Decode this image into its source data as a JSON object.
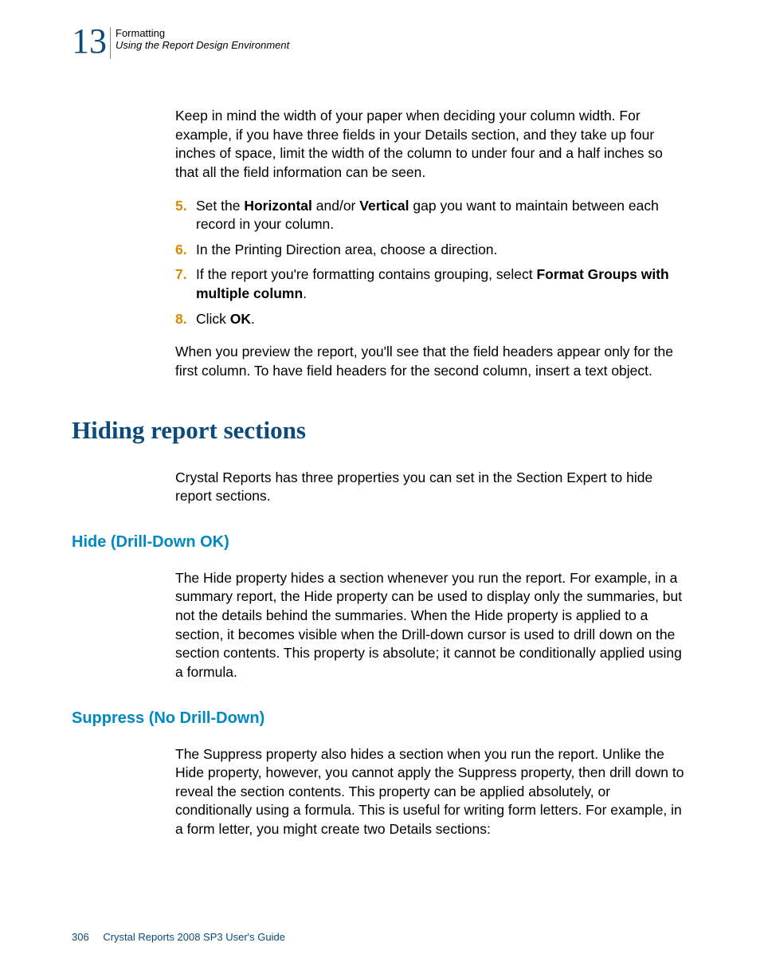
{
  "header": {
    "chapter_number": "13",
    "chapter_title": "Formatting",
    "section_title": "Using the Report Design Environment"
  },
  "body": {
    "intro_para": "Keep in mind the width of your paper when deciding your column width. For example, if you have three fields in your Details section, and they take up four inches of space, limit the width of the column to under four and a half inches so that all the field information can be seen.",
    "step5": {
      "num": "5.",
      "pre": "Set the ",
      "b1": "Horizontal",
      "mid": " and/or ",
      "b2": "Vertical",
      "post": " gap you want to maintain between each record in your column."
    },
    "step6": {
      "num": "6.",
      "text": "In the Printing Direction area, choose a direction."
    },
    "step7": {
      "num": "7.",
      "pre": "If the report you're formatting contains grouping, select ",
      "b1": "Format Groups with multiple column",
      "post": "."
    },
    "step8": {
      "num": "8.",
      "pre": "Click ",
      "b1": "OK",
      "post": "."
    },
    "outro_para": "When you preview the report, you'll see that the field headers appear only for the first column. To have field headers for the second column, insert a text object."
  },
  "h1": "Hiding report sections",
  "hiding_intro": "Crystal Reports has three properties you can set in the Section Expert to hide report sections.",
  "hide": {
    "title": "Hide (Drill-Down OK)",
    "body": "The Hide property hides a section whenever you run the report. For example, in a summary report, the Hide property can be used to display only the summaries, but not the details behind the summaries. When the Hide property is applied to a section, it becomes visible when the Drill-down cursor is used to drill down on the section contents. This property is absolute; it cannot be conditionally applied using a formula."
  },
  "suppress": {
    "title": "Suppress (No Drill-Down)",
    "body": "The Suppress property also hides a section when you run the report. Unlike the Hide property, however, you cannot apply the Suppress property, then drill down to reveal the section contents. This property can be applied absolutely, or conditionally using a formula. This is useful for writing form letters. For example, in a form letter, you might create two Details sections:"
  },
  "footer": {
    "page_number": "306",
    "doc_title": "Crystal Reports 2008 SP3 User's Guide"
  }
}
